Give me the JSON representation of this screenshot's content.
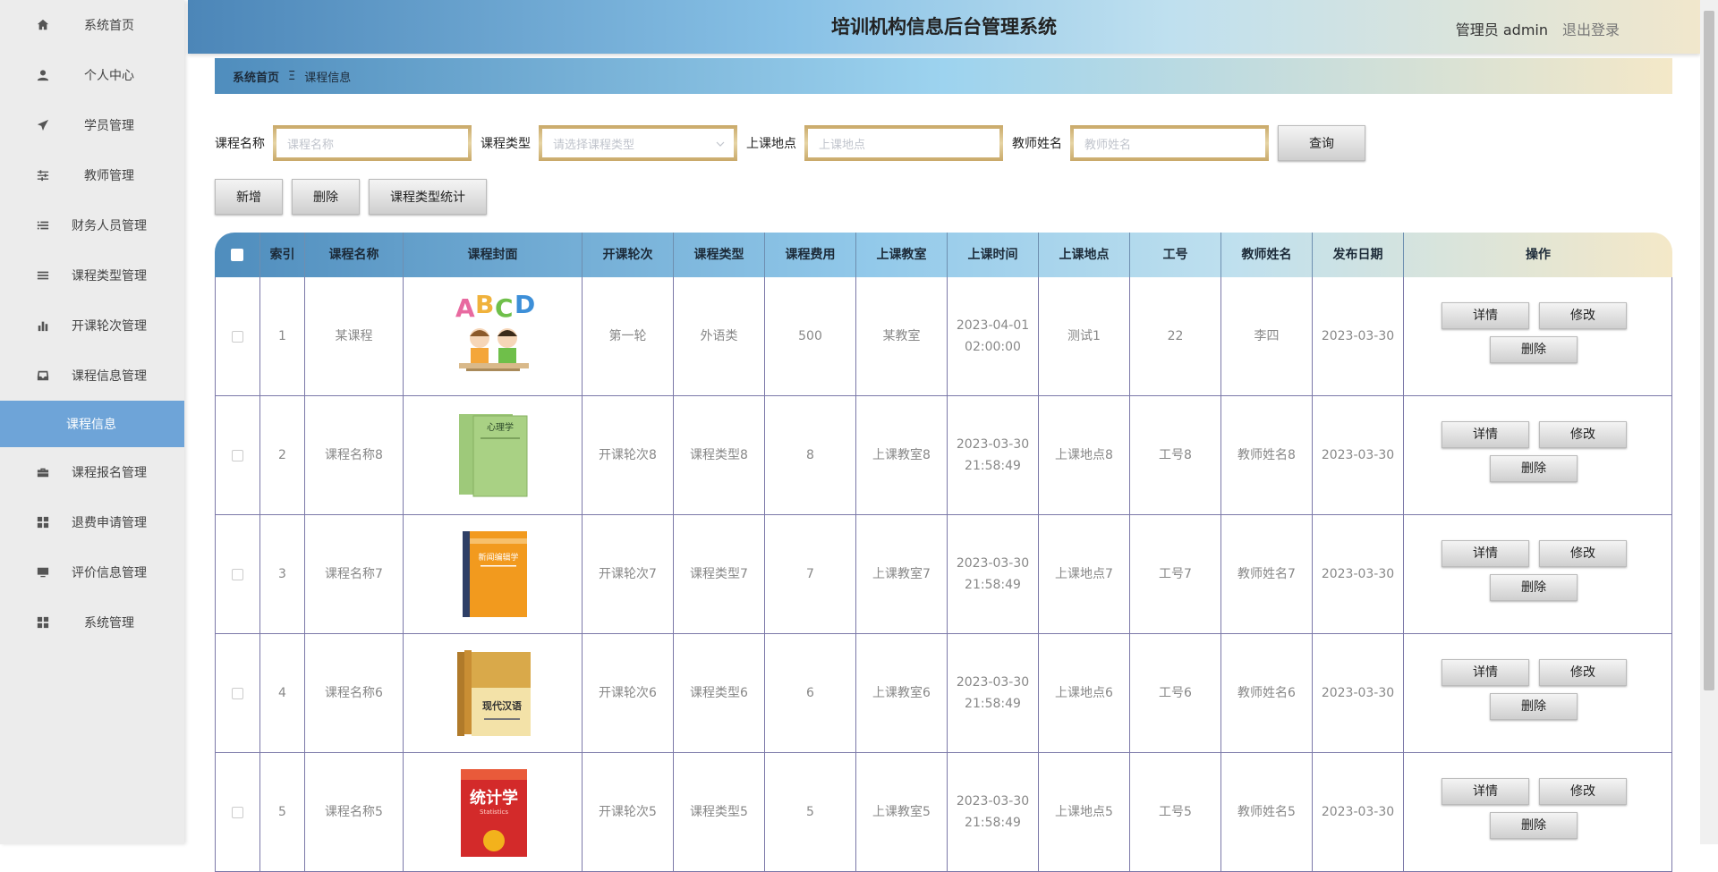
{
  "header": {
    "title": "培训机构信息后台管理系统",
    "admin": "管理员 admin",
    "logout": "退出登录"
  },
  "sidebar": {
    "items": [
      {
        "label": "系统首页",
        "icon": "home-icon"
      },
      {
        "label": "个人中心",
        "icon": "user-icon"
      },
      {
        "label": "学员管理",
        "icon": "paper-plane-icon"
      },
      {
        "label": "教师管理",
        "icon": "sliders-icon"
      },
      {
        "label": "财务人员管理",
        "icon": "list-icon"
      },
      {
        "label": "课程类型管理",
        "icon": "bars-icon"
      },
      {
        "label": "开课轮次管理",
        "icon": "bar-chart-icon"
      },
      {
        "label": "课程信息管理",
        "icon": "inbox-icon"
      },
      {
        "label": "课程信息",
        "icon": "",
        "sub": true
      },
      {
        "label": "课程报名管理",
        "icon": "briefcase-icon"
      },
      {
        "label": "退费申请管理",
        "icon": "grid-icon"
      },
      {
        "label": "评价信息管理",
        "icon": "monitor-icon"
      },
      {
        "label": "系统管理",
        "icon": "grid-icon"
      }
    ]
  },
  "breadcrumb": {
    "home": "系统首页",
    "sep": "Ξ",
    "current": "课程信息"
  },
  "search": {
    "name_label": "课程名称",
    "name_placeholder": "课程名称",
    "type_label": "课程类型",
    "type_placeholder": "请选择课程类型",
    "place_label": "上课地点",
    "place_placeholder": "上课地点",
    "teacher_label": "教师姓名",
    "teacher_placeholder": "教师姓名",
    "query": "查询"
  },
  "actions": {
    "add": "新增",
    "delete": "删除",
    "stats": "课程类型统计"
  },
  "table": {
    "columns": [
      "索引",
      "课程名称",
      "课程封面",
      "开课轮次",
      "课程类型",
      "课程费用",
      "上课教室",
      "上课时间",
      "上课地点",
      "工号",
      "教师姓名",
      "发布日期",
      "操作"
    ],
    "ops": {
      "detail": "详情",
      "edit": "修改",
      "delete": "删除"
    },
    "rows": [
      {
        "index": "1",
        "name": "某课程",
        "round": "第一轮",
        "type": "外语类",
        "fee": "500",
        "room": "某教室",
        "time_date": "2023-04-01",
        "time_clock": "02:00:00",
        "place": "测试1",
        "emp_no": "22",
        "teacher": "李四",
        "date": "2023-03-30",
        "cover": "abcd-kids"
      },
      {
        "index": "2",
        "name": "课程名称8",
        "round": "开课轮次8",
        "type": "课程类型8",
        "fee": "8",
        "room": "上课教室8",
        "time_date": "2023-03-30",
        "time_clock": "21:58:49",
        "place": "上课地点8",
        "emp_no": "工号8",
        "teacher": "教师姓名8",
        "date": "2023-03-30",
        "cover": "green-book"
      },
      {
        "index": "3",
        "name": "课程名称7",
        "round": "开课轮次7",
        "type": "课程类型7",
        "fee": "7",
        "room": "上课教室7",
        "time_date": "2023-03-30",
        "time_clock": "21:58:49",
        "place": "上课地点7",
        "emp_no": "工号7",
        "teacher": "教师姓名7",
        "date": "2023-03-30",
        "cover": "orange-book"
      },
      {
        "index": "4",
        "name": "课程名称6",
        "round": "开课轮次6",
        "type": "课程类型6",
        "fee": "6",
        "room": "上课教室6",
        "time_date": "2023-03-30",
        "time_clock": "21:58:49",
        "place": "上课地点6",
        "emp_no": "工号6",
        "teacher": "教师姓名6",
        "date": "2023-03-30",
        "cover": "yellow-book"
      },
      {
        "index": "5",
        "name": "课程名称5",
        "round": "开课轮次5",
        "type": "课程类型5",
        "fee": "5",
        "room": "上课教室5",
        "time_date": "2023-03-30",
        "time_clock": "21:58:49",
        "place": "上课地点5",
        "emp_no": "工号5",
        "teacher": "教师姓名5",
        "date": "2023-03-30",
        "cover": "red-book"
      }
    ]
  },
  "covers": {
    "abcd_letters": [
      "A",
      "B",
      "C",
      "D"
    ],
    "green_book_title": "心理学",
    "orange_book_title": "新闻编辑学",
    "yellow_book_title": "现代汉语",
    "red_book_title": "统计学",
    "red_book_subtitle": "Statistics"
  }
}
